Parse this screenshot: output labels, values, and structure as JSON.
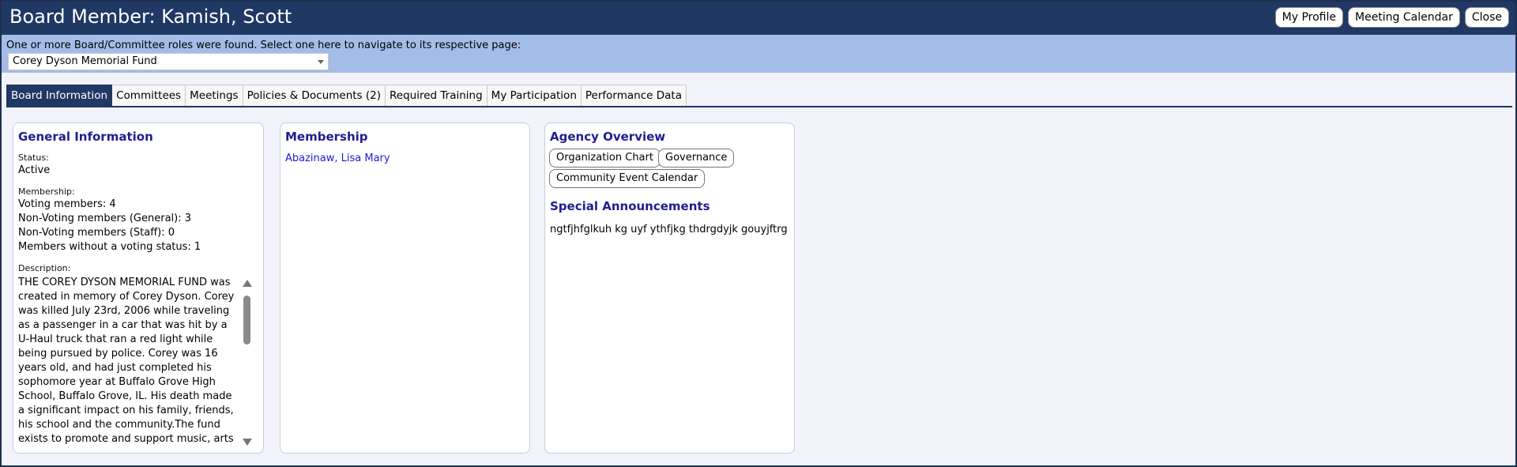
{
  "window": {
    "title": "Board Member: Kamish, Scott"
  },
  "top_buttons": {
    "profile": "My Profile",
    "calendar": "Meeting Calendar",
    "close": "Close"
  },
  "roles": {
    "message": "One or more Board/Committee roles were found.  Select one here to navigate to its respective page:",
    "selected": "Corey Dyson Memorial Fund"
  },
  "tabs": [
    {
      "label": "Board Information",
      "active": true
    },
    {
      "label": "Committees"
    },
    {
      "label": "Meetings"
    },
    {
      "label": "Policies & Documents (2)"
    },
    {
      "label": "Required Training"
    },
    {
      "label": "My Participation"
    },
    {
      "label": "Performance Data"
    }
  ],
  "general": {
    "heading": "General Information",
    "status_label": "Status:",
    "status_value": "Active",
    "membership_label": "Membership:",
    "voting": "Voting members: 4",
    "nonvoting_general": "Non-Voting members (General): 3",
    "nonvoting_staff": "Non-Voting members (Staff): 0",
    "no_status": "Members without a voting status: 1",
    "description_label": "Description:",
    "description": "THE COREY DYSON MEMORIAL FUND was created in memory of Corey Dyson. Corey was killed July 23rd, 2006 while traveling as a passenger in a car that was hit by a U-Haul truck that ran a red light while being pursued by police. Corey was 16 years old, and had just completed his sophomore year at Buffalo Grove High School, Buffalo Grove, IL. His death made a significant impact on his family, friends, his school and the community.The fund exists to promote and support music, arts and community service programs as"
  },
  "membership": {
    "heading": "Membership",
    "members": [
      "Abazinaw, Lisa Mary"
    ]
  },
  "agency": {
    "heading": "Agency Overview",
    "buttons": {
      "org_chart": "Organization Chart",
      "governance": "Governance",
      "event_calendar": "Community Event Calendar"
    },
    "special_heading": "Special Announcements",
    "special_text": "ngtfjhfglkuh kg uyf ythfjkg thdrgdyjk gouyjftrg"
  }
}
